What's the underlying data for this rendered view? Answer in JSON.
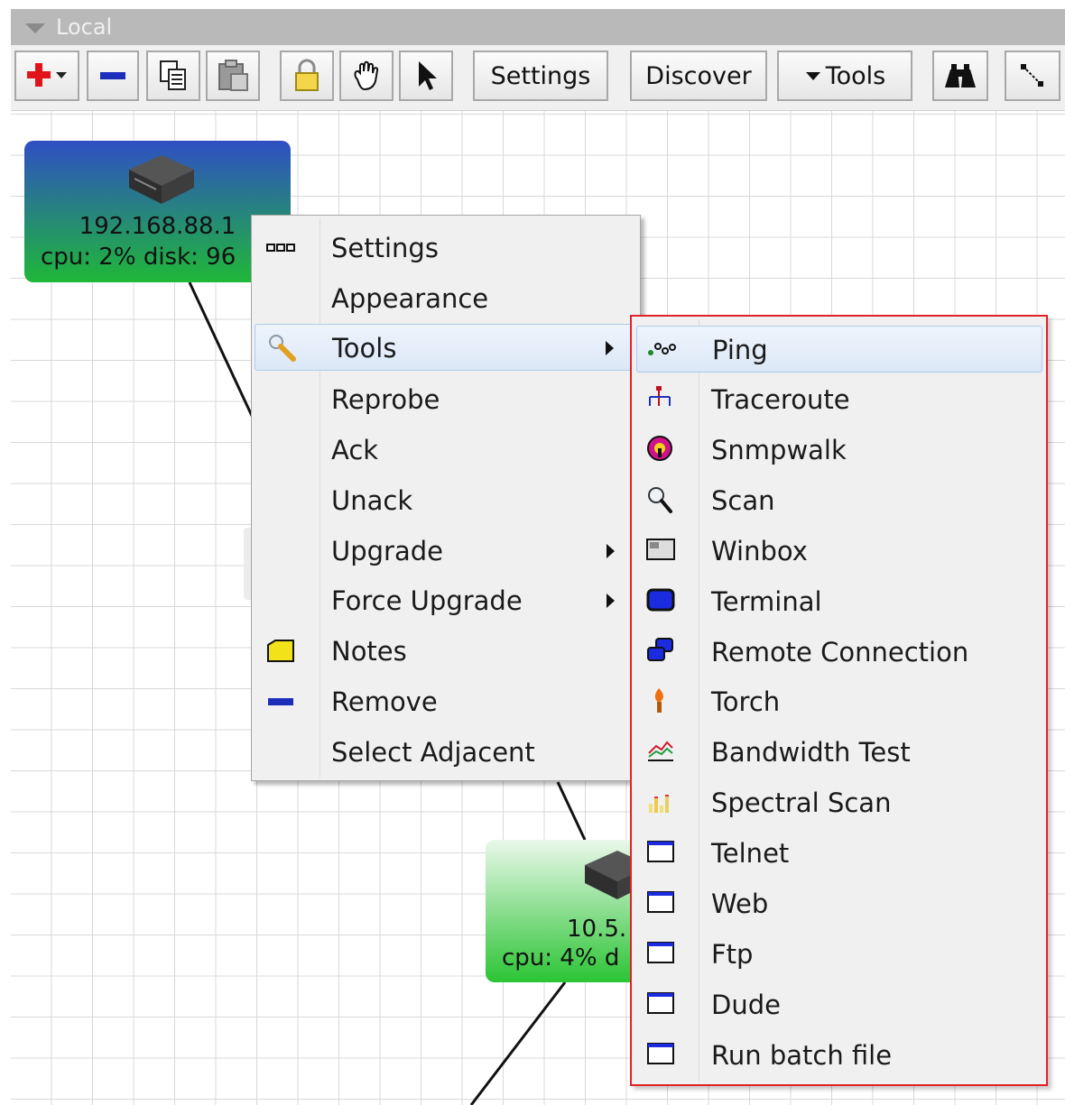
{
  "window": {
    "title": "Local"
  },
  "toolbar": {
    "add_icon": "plus-with-dropdown-icon",
    "remove_icon": "minus-icon",
    "copy_icon": "copy-icon",
    "paste_icon": "paste-icon",
    "lock_icon": "padlock-icon",
    "hand_icon": "hand-pan-icon",
    "pointer_icon": "arrow-pointer-icon",
    "settings_label": "Settings",
    "discover_label": "Discover",
    "tools_label": "Tools",
    "find_icon": "binoculars-icon",
    "link_icon": "link-mode-icon"
  },
  "map": {
    "nodes": [
      {
        "address": "192.168.88.1",
        "stats": "cpu: 2% disk: 96",
        "icon": "router-device-icon",
        "gradient": [
          "#2f4fc4",
          "#1fb838"
        ]
      },
      {
        "address": "10.5.",
        "stats": "cpu: 4% d",
        "icon": "router-device-icon",
        "gradient": [
          "#eaf8ea",
          "#2bc434"
        ]
      }
    ]
  },
  "context_menu": {
    "items": [
      {
        "label": "Settings",
        "icon": "dots-icon"
      },
      {
        "label": "Appearance"
      },
      {
        "label": "Tools",
        "icon": "wrench-icon",
        "submenu": true,
        "highlighted": true
      },
      {
        "label": "Reprobe"
      },
      {
        "label": "Ack"
      },
      {
        "label": "Unack"
      },
      {
        "label": "Upgrade",
        "submenu": true
      },
      {
        "label": "Force Upgrade",
        "submenu": true
      },
      {
        "label": "Notes",
        "icon": "note-icon"
      },
      {
        "label": "Remove",
        "icon": "minus-icon"
      },
      {
        "label": "Select Adjacent"
      }
    ]
  },
  "tools_submenu": {
    "highlight_color": "#e0222a",
    "items": [
      {
        "label": "Ping",
        "icon": "ping-icon",
        "highlighted": true
      },
      {
        "label": "Traceroute",
        "icon": "traceroute-icon"
      },
      {
        "label": "Snmpwalk",
        "icon": "snmpwalk-icon"
      },
      {
        "label": "Scan",
        "icon": "magnifier-icon"
      },
      {
        "label": "Winbox",
        "icon": "winbox-icon"
      },
      {
        "label": "Terminal",
        "icon": "terminal-icon"
      },
      {
        "label": "Remote Connection",
        "icon": "remote-connection-icon"
      },
      {
        "label": "Torch",
        "icon": "torch-icon"
      },
      {
        "label": "Bandwidth Test",
        "icon": "bandwidth-test-icon"
      },
      {
        "label": "Spectral Scan",
        "icon": "spectral-scan-icon"
      },
      {
        "label": "Telnet",
        "icon": "window-icon"
      },
      {
        "label": "Web",
        "icon": "window-icon"
      },
      {
        "label": "Ftp",
        "icon": "window-icon"
      },
      {
        "label": "Dude",
        "icon": "window-icon"
      },
      {
        "label": "Run batch file",
        "icon": "window-icon"
      }
    ]
  }
}
